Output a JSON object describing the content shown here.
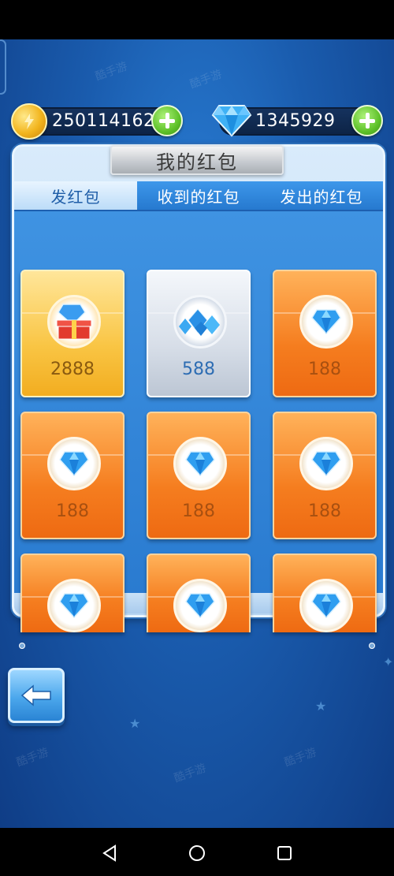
{
  "currency": {
    "gold_value": "250114162",
    "gem_value": "1345929"
  },
  "panel": {
    "title": "我的红包"
  },
  "tabs": [
    {
      "label": "发红包",
      "active": true
    },
    {
      "label": "收到的红包",
      "active": false
    },
    {
      "label": "发出的红包",
      "active": false
    }
  ],
  "cards": [
    {
      "amount": "2888",
      "style": "gold",
      "icon": "gift-gem-icon"
    },
    {
      "amount": "588",
      "style": "silver",
      "icon": "gem-pile-icon"
    },
    {
      "amount": "188",
      "style": "orange",
      "icon": "diamond-icon"
    },
    {
      "amount": "188",
      "style": "orange",
      "icon": "diamond-icon"
    },
    {
      "amount": "188",
      "style": "orange",
      "icon": "diamond-icon"
    },
    {
      "amount": "188",
      "style": "orange",
      "icon": "diamond-icon"
    },
    {
      "amount": "",
      "style": "orange",
      "icon": "diamond-icon"
    },
    {
      "amount": "",
      "style": "orange",
      "icon": "diamond-icon"
    },
    {
      "amount": "",
      "style": "orange",
      "icon": "diamond-icon"
    }
  ],
  "colors": {
    "accent_blue": "#2a7bd0",
    "card_orange": "#f57d1f",
    "plus_green": "#5fc22a"
  },
  "watermark_text": "酷手游"
}
